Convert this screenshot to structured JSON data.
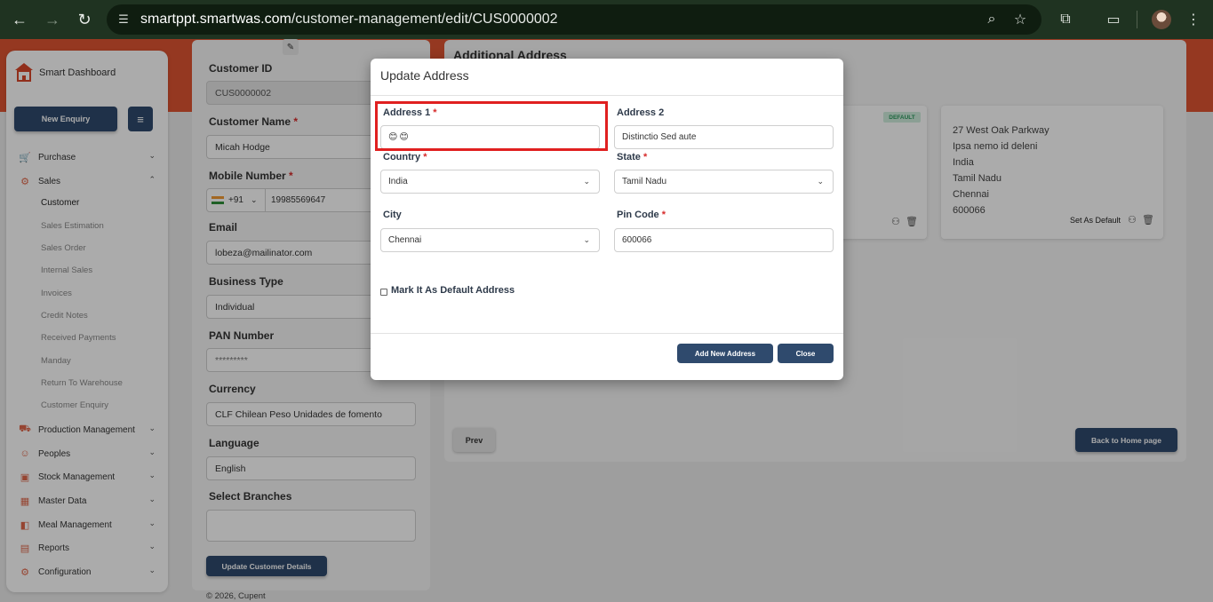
{
  "browser": {
    "url_host": "smartppt.smartwas.com",
    "url_path": "/customer-management/edit/CUS0000002"
  },
  "icons": {
    "back": "back-arrow-icon",
    "forward": "forward-arrow-icon",
    "reload": "reload-icon",
    "site_info": "tune-icon",
    "zoom": "zoom-icon",
    "bookmark": "star-icon",
    "extensions": "puzzle-icon",
    "cast": "cast-icon",
    "menu": "kebab-menu-icon"
  },
  "sidebar": {
    "brand_title": "Smart Dashboard",
    "new_enquiry": "New Enquiry",
    "menu_toggle": "≡",
    "items": [
      {
        "label": "Purchase",
        "icon": "cart-icon"
      },
      {
        "label": "Sales",
        "icon": "sales-icon"
      },
      {
        "label": "Production Management",
        "icon": "truck-icon"
      },
      {
        "label": "Peoples",
        "icon": "people-icon"
      },
      {
        "label": "Stock Management",
        "icon": "box-icon"
      },
      {
        "label": "Master Data",
        "icon": "database-icon"
      },
      {
        "label": "Meal Management",
        "icon": "meal-icon"
      },
      {
        "label": "Reports",
        "icon": "report-icon"
      },
      {
        "label": "Configuration",
        "icon": "config-icon"
      }
    ],
    "sales_sub": [
      "Customer",
      "Sales Estimation",
      "Sales Order",
      "Internal Sales",
      "Invoices",
      "Credit Notes",
      "Received Payments",
      "Manday",
      "Return To Warehouse",
      "Customer Enquiry"
    ]
  },
  "form": {
    "customer_id_label": "Customer ID",
    "customer_id": "CUS0000002",
    "customer_name_label": "Customer Name",
    "customer_name": "Micah Hodge",
    "mobile_label": "Mobile Number",
    "dial_code": "+91",
    "mobile": "19985569647",
    "email_label": "Email",
    "email": "lobeza@mailinator.com",
    "business_type_label": "Business Type",
    "business_type": "Individual",
    "pan_label": "PAN Number",
    "pan": "*********",
    "currency_label": "Currency",
    "currency": "CLF Chilean Peso Unidades de fomento",
    "language_label": "Language",
    "language": "English",
    "branches_label": "Select Branches",
    "branches": "",
    "required_mark": "*",
    "update_button": "Update Customer Details"
  },
  "footer": "© 2026, Cupent",
  "additional": {
    "title": "Additional Address",
    "default_badge": "DEFAULT",
    "address2": [
      "27 West Oak Parkway",
      "Ipsa nemo id deleni",
      "India",
      "Tamil Nadu",
      "Chennai",
      "600066"
    ],
    "set_default": "Set As Default",
    "prev": "Prev",
    "back_home": "Back to Home page"
  },
  "modal": {
    "title": "Update Address",
    "address1_label": "Address 1",
    "address1_value": "😊😊",
    "address2_label": "Address 2",
    "address2_value": "Distinctio Sed aute",
    "country_label": "Country",
    "country_value": "India",
    "state_label": "State",
    "state_value": "Tamil Nadu",
    "city_label": "City",
    "city_value": "Chennai",
    "pincode_label": "Pin Code",
    "pincode_value": "600066",
    "default_checkbox_label": "Mark It As Default Address",
    "add_button": "Add New Address",
    "close_button": "Close",
    "required_mark": "*"
  },
  "colors": {
    "brand_orange": "#de5432",
    "primary_navy": "#2f4a6d",
    "highlight_red": "#e02020",
    "browser_green": "#1f3321"
  }
}
